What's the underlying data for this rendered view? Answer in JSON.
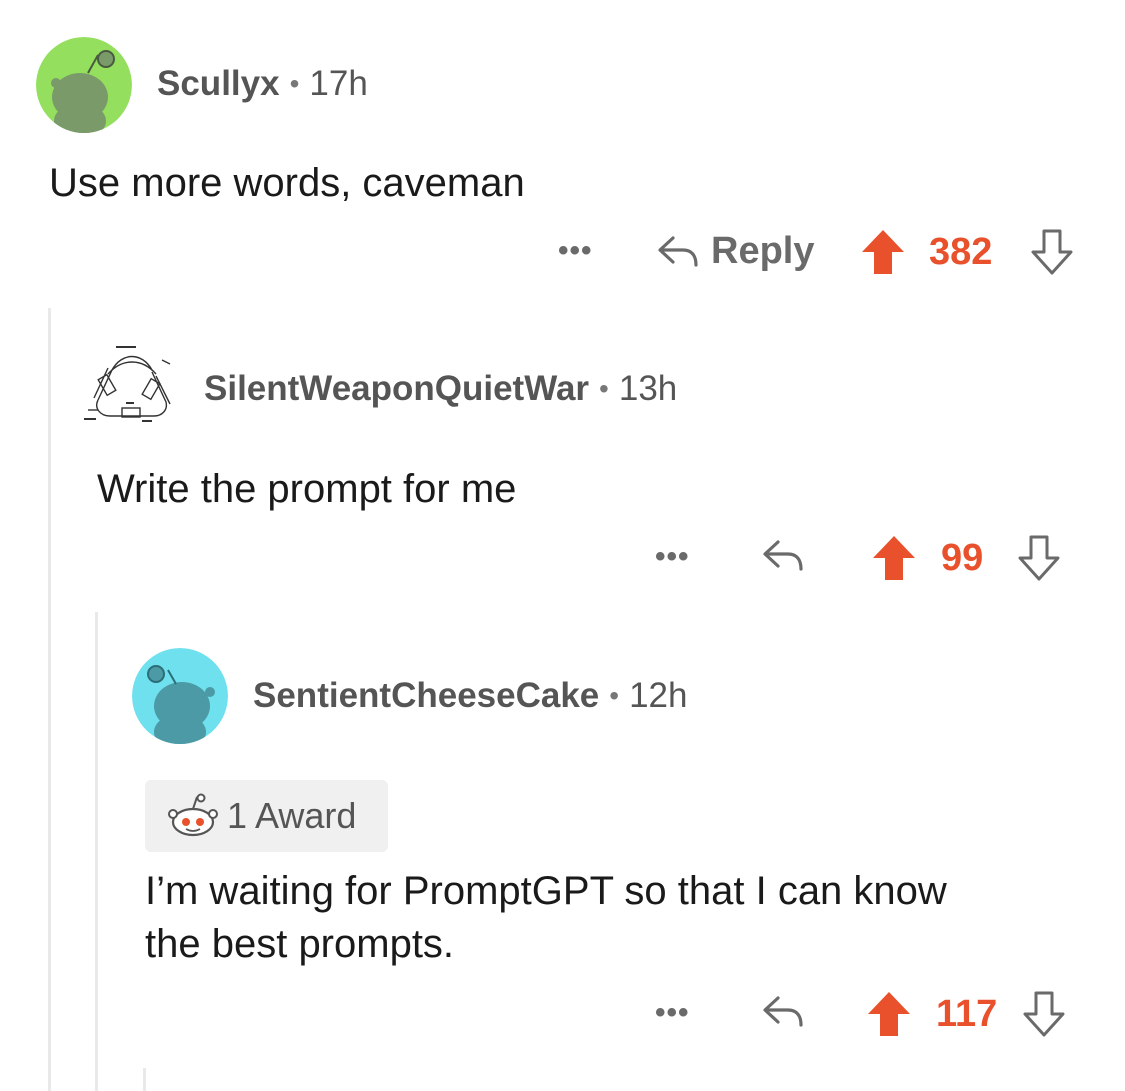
{
  "colors": {
    "upvote": "#e8512b",
    "thread_line": "#e9e9e9",
    "meta_text": "#555555"
  },
  "comments": [
    {
      "username": "Scullyx",
      "separator": "•",
      "time": "17h",
      "avatar_icon": "snoo-avatar-green-icon",
      "body": "Use more words, caveman",
      "more": "•••",
      "reply_label": "Reply",
      "score": "382"
    },
    {
      "username": "SilentWeaponQuietWar",
      "separator": "•",
      "time": "13h",
      "avatar_icon": "diagram-avatar-icon",
      "body": "Write the prompt for me",
      "more": "•••",
      "score": "99"
    },
    {
      "username": "SentientCheeseCake",
      "separator": "•",
      "time": "12h",
      "avatar_icon": "snoo-avatar-blue-icon",
      "award_label": "1 Award",
      "body_line1": "I’m waiting for PromptGPT so that I can know",
      "body_line2": "the best prompts.",
      "more": "•••",
      "score": "117"
    }
  ]
}
